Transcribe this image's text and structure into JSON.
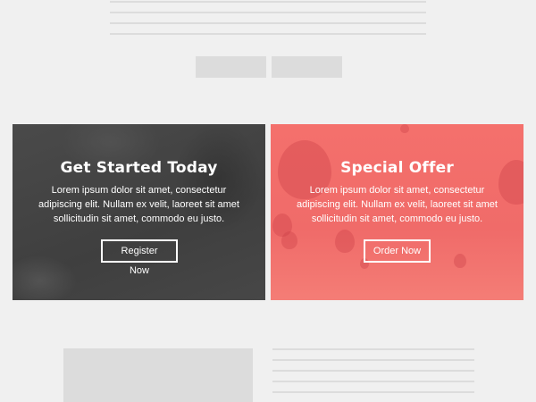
{
  "cards": [
    {
      "title": "Get Started Today",
      "body": "Lorem ipsum dolor sit amet, consectetur adipiscing elit. Nullam ex velit, laoreet sit amet sollicitudin sit amet, commodo eu justo.",
      "button_label": "Register Now"
    },
    {
      "title": "Special Offer",
      "body": "Lorem ipsum dolor sit amet, consectetur adipiscing elit. Nullam ex velit, laoreet sit amet sollicitudin sit amet, commodo eu justo.",
      "button_label": "Order Now"
    }
  ],
  "colors": {
    "left_card_bg": "#454545",
    "right_card_bg": "#f26d6b",
    "placeholder": "#dcdcdc",
    "page_bg": "#f0f0f0"
  }
}
